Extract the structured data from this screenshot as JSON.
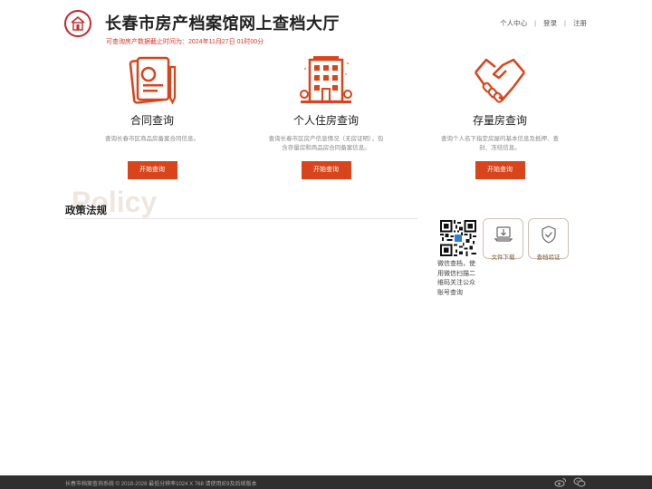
{
  "header": {
    "site_title": "长春市房产档案馆网上查档大厅",
    "data_note": "可查询房产数据截止时间为：2024年11月27日 01时00分",
    "links": {
      "personal_center": "个人中心",
      "login": "登录",
      "register": "注册",
      "separator": "|"
    }
  },
  "services": [
    {
      "title": "合同查询",
      "desc": "查询长春市区商品房备案合同信息。",
      "button": "开始查询",
      "icon": "contract-icon"
    },
    {
      "title": "个人住房查询",
      "desc": "查询长春市区房产信息情况（无房证明），包含存量房和商品房合同备案信息。",
      "button": "开始查询",
      "icon": "building-icon"
    },
    {
      "title": "存量房查询",
      "desc": "查询个人名下指定房屋的基本信息及抵押、查封、冻结信息。",
      "button": "开始查询",
      "icon": "handshake-icon"
    }
  ],
  "policy": {
    "watermark": "Policy",
    "title": "政策法规"
  },
  "side": {
    "qr_text": "微信查档，使用微信扫描二维码关注公众账号查询",
    "download_label": "文件下载",
    "verify_label": "查档验证"
  },
  "footer": {
    "text": "长春市档案查询系统 © 2018-2028 最低分辨率1024 X 768 请使用IE9及后续版本"
  },
  "colors": {
    "accent": "#d9441b",
    "brand_red": "#c4272b",
    "footer_bg": "#2f2f2f"
  }
}
